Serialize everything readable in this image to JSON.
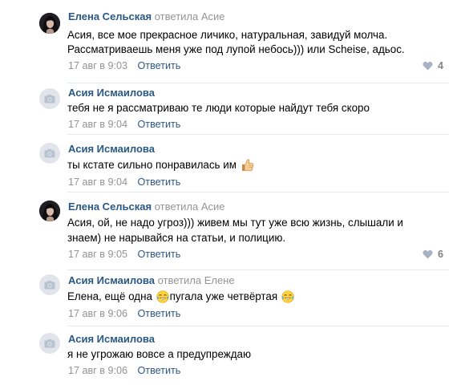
{
  "comments": [
    {
      "author": "Елена Сельская",
      "reply_to": "ответила Асие",
      "lines": [
        "Асия, все мое прекрасное личико, натуральная, завидуй молча.",
        "Рассматриваешь меня уже под лупой небось))) или Scheise, адьос."
      ],
      "date": "17 авг в 9:03",
      "reply_label": "Ответить",
      "likes": "4"
    },
    {
      "author": "Асия Исмаилова",
      "lines": [
        "тебя не я рассматриваю те люди которые найдут тебя скоро"
      ],
      "date": "17 авг в 9:04",
      "reply_label": "Ответить"
    },
    {
      "author": "Асия Исмаилова",
      "lines": [
        "ты кстате сильно понравилась им"
      ],
      "date": "17 авг в 9:04",
      "reply_label": "Ответить"
    },
    {
      "author": "Елена Сельская",
      "reply_to": "ответила Асие",
      "lines": [
        "Асия, ой, не надо угроз))) живем мы тут уже всю жизнь, слышали и",
        "знаем) не нарывайся на статьи, и полицию."
      ],
      "date": "17 авг в 9:05",
      "reply_label": "Ответить",
      "likes": "6"
    },
    {
      "author": "Асия Исмаилова",
      "reply_to": "ответила Елене",
      "lines_parts": [
        "Елена, ещё одна",
        "пугала уже четвёртая"
      ],
      "date": "17 авг в 9:06",
      "reply_label": "Ответить"
    },
    {
      "author": "Асия Исмаилова",
      "lines": [
        "я не угрожаю вовсе а предупреждаю"
      ],
      "date": "17 авг в 9:06",
      "reply_label": "Ответить"
    }
  ],
  "icons": {
    "like": "heart-icon",
    "placeholder_avatar": "camera-icon",
    "emoji_thumbs": "thumbs-up-emoji",
    "emoji_laugh": "tears-of-joy-emoji"
  },
  "colors": {
    "author_link": "#2a5885",
    "meta_gray": "#939393",
    "divider": "#e7e8ec",
    "avatar_placeholder": "#e1e5eb"
  }
}
